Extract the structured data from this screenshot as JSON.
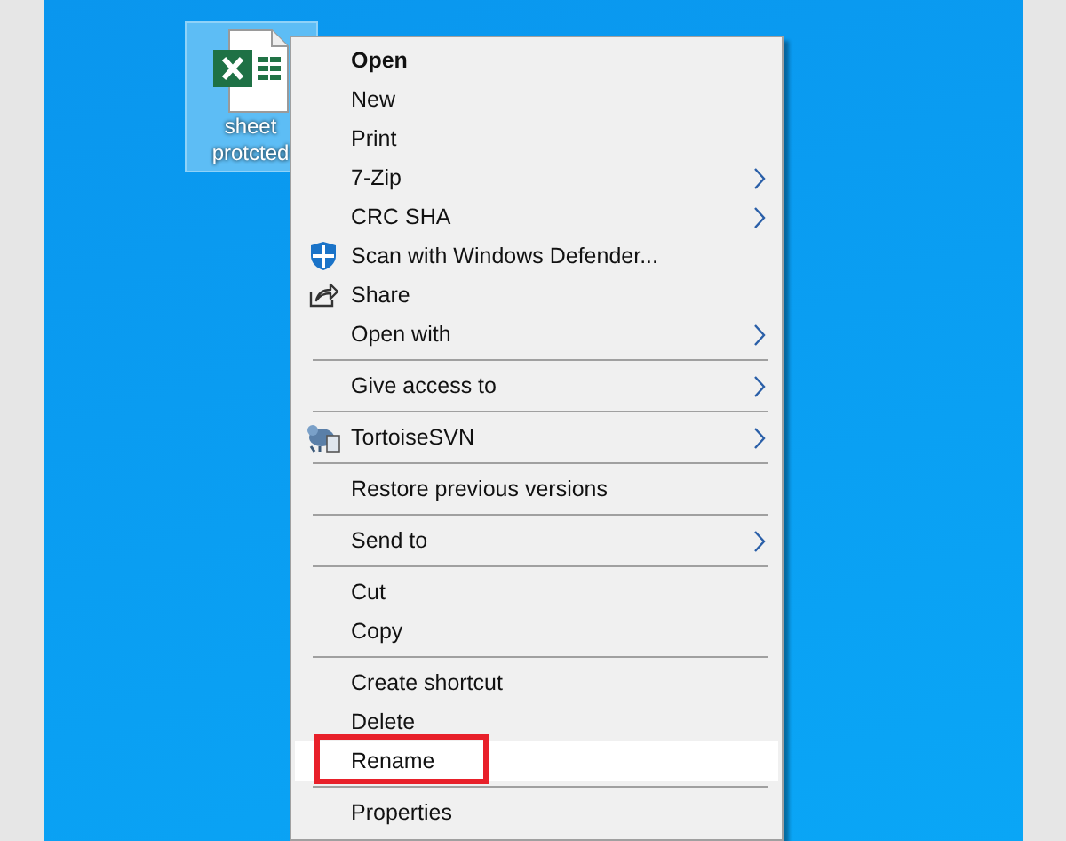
{
  "desktop_icon": {
    "label": "sheet protcted",
    "selected": true
  },
  "context_menu": {
    "items": [
      {
        "kind": "item",
        "label": "Open",
        "bold": true,
        "submenu": false,
        "selected": false
      },
      {
        "kind": "item",
        "label": "New",
        "bold": false,
        "submenu": false,
        "selected": false
      },
      {
        "kind": "item",
        "label": "Print",
        "bold": false,
        "submenu": false,
        "selected": false
      },
      {
        "kind": "item",
        "label": "7-Zip",
        "bold": false,
        "submenu": true,
        "selected": false
      },
      {
        "kind": "item",
        "label": "CRC SHA",
        "bold": false,
        "submenu": true,
        "selected": false
      },
      {
        "kind": "item",
        "label": "Scan with Windows Defender...",
        "bold": false,
        "submenu": false,
        "selected": false
      },
      {
        "kind": "item",
        "label": "Share",
        "bold": false,
        "submenu": false,
        "selected": false
      },
      {
        "kind": "item",
        "label": "Open with",
        "bold": false,
        "submenu": true,
        "selected": false
      },
      {
        "kind": "separator"
      },
      {
        "kind": "item",
        "label": "Give access to",
        "bold": false,
        "submenu": true,
        "selected": false
      },
      {
        "kind": "separator"
      },
      {
        "kind": "item",
        "label": "TortoiseSVN",
        "bold": false,
        "submenu": true,
        "selected": false
      },
      {
        "kind": "separator"
      },
      {
        "kind": "item",
        "label": "Restore previous versions",
        "bold": false,
        "submenu": false,
        "selected": false
      },
      {
        "kind": "separator"
      },
      {
        "kind": "item",
        "label": "Send to",
        "bold": false,
        "submenu": true,
        "selected": false
      },
      {
        "kind": "separator"
      },
      {
        "kind": "item",
        "label": "Cut",
        "bold": false,
        "submenu": false,
        "selected": false
      },
      {
        "kind": "item",
        "label": "Copy",
        "bold": false,
        "submenu": false,
        "selected": false
      },
      {
        "kind": "separator"
      },
      {
        "kind": "item",
        "label": "Create shortcut",
        "bold": false,
        "submenu": false,
        "selected": false
      },
      {
        "kind": "item",
        "label": "Delete",
        "bold": false,
        "submenu": false,
        "selected": false
      },
      {
        "kind": "item",
        "label": "Rename",
        "bold": false,
        "submenu": false,
        "selected": true,
        "annotated": true
      },
      {
        "kind": "separator"
      },
      {
        "kind": "item",
        "label": "Properties",
        "bold": false,
        "submenu": false,
        "selected": false
      }
    ]
  }
}
